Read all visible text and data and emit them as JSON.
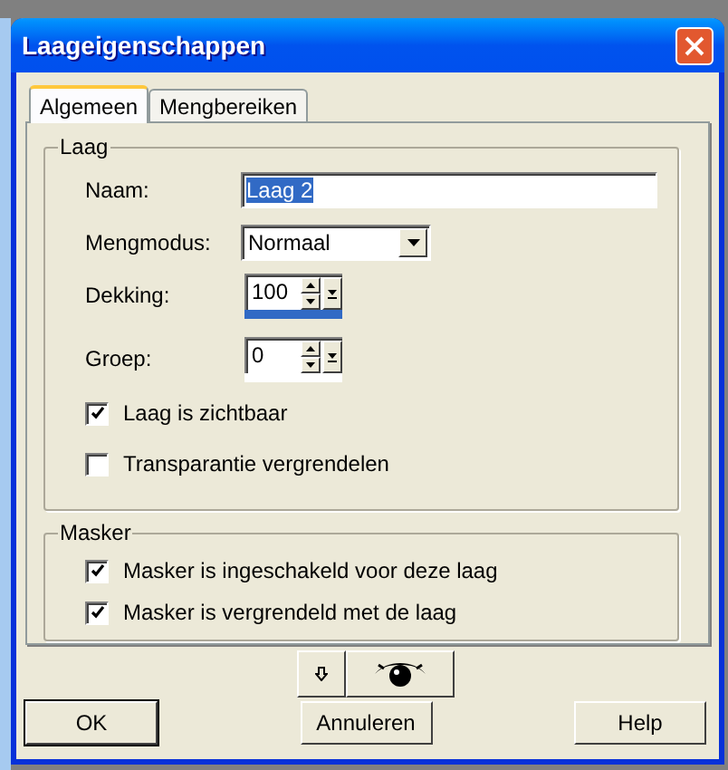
{
  "window": {
    "title": "Laageigenschappen"
  },
  "tabs": [
    {
      "label": "Algemeen",
      "selected": true
    },
    {
      "label": "Mengbereiken",
      "selected": false
    }
  ],
  "layer_group": {
    "title": "Laag",
    "name": {
      "label": "Naam:",
      "value": "Laag 2"
    },
    "blend_mode": {
      "label": "Mengmodus:",
      "value": "Normaal"
    },
    "spinners": [
      {
        "label": "Dekking:",
        "value": "100",
        "focused": true
      },
      {
        "label": "Groep:",
        "value": "0",
        "focused": false
      }
    ],
    "checkboxes": [
      {
        "label": "Laag is zichtbaar",
        "checked": true
      },
      {
        "label": "Transparantie vergrendelen",
        "checked": false
      }
    ]
  },
  "mask_group": {
    "title": "Masker",
    "checkboxes": [
      {
        "label": "Masker is ingeschakeld voor deze laag",
        "checked": true
      },
      {
        "label": "Masker is vergrendeld met de laag",
        "checked": true
      }
    ]
  },
  "buttons": [
    "OK",
    "Annuleren",
    "Help"
  ]
}
